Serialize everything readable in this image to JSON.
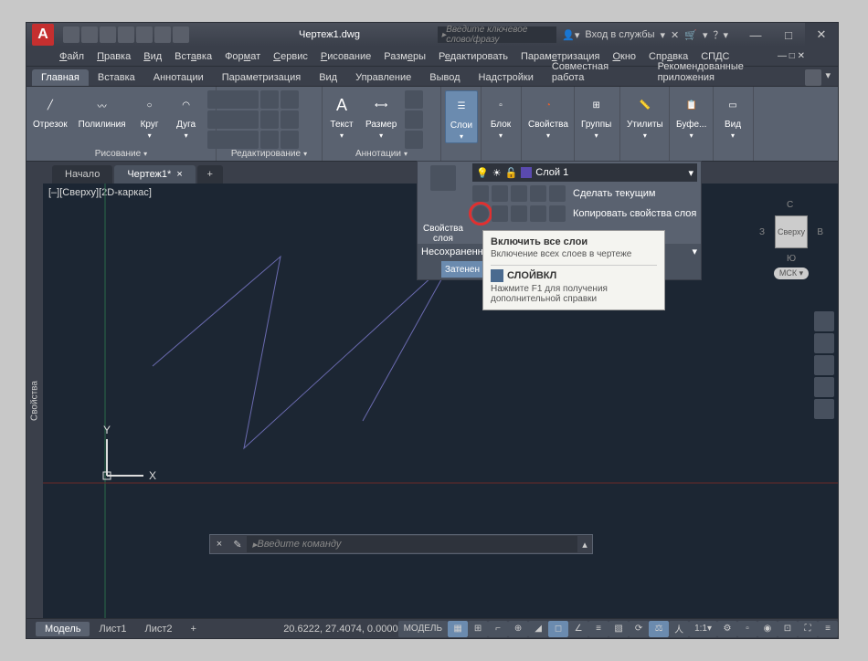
{
  "window": {
    "app_initial": "А",
    "title": "Чертеж1.dwg",
    "search_placeholder": "Введите ключевое слово/фразу",
    "login_label": "Вход в службы",
    "win_min": "—",
    "win_max": "□",
    "win_close": "✕"
  },
  "menubar": [
    "Файл",
    "Правка",
    "Вид",
    "Вставка",
    "Формат",
    "Сервис",
    "Рисование",
    "Размеры",
    "Редактировать",
    "Параметризация",
    "Окно",
    "Справка",
    "СПДС"
  ],
  "ribbon_tabs": [
    "Главная",
    "Вставка",
    "Аннотации",
    "Параметризация",
    "Вид",
    "Управление",
    "Вывод",
    "Надстройки",
    "Совместная работа",
    "Рекомендованные приложения"
  ],
  "ribbon_active": 0,
  "panels": {
    "draw": {
      "title": "Рисование",
      "items": [
        "Отрезок",
        "Полилиния",
        "Круг",
        "Дуга"
      ]
    },
    "modify": {
      "title": "Редактирование"
    },
    "annotation": {
      "title": "Аннотации",
      "items": [
        "Текст",
        "Размер"
      ]
    },
    "layers": {
      "title": "Слои"
    },
    "block": {
      "title": "Блок"
    },
    "properties": {
      "title": "Свойства"
    },
    "groups": {
      "title": "Группы"
    },
    "utilities": {
      "title": "Утилиты"
    },
    "clipboard": {
      "title": "Буфе..."
    },
    "view": {
      "title": "Вид"
    }
  },
  "filetabs": {
    "start": "Начало",
    "active": "Чертеж1*",
    "plus": "+"
  },
  "viewport": {
    "label": "[–][Сверху][2D-каркас]",
    "side_label": "Свойства",
    "axis_x": "X",
    "axis_y": "Y",
    "cube": "Сверху",
    "compass": {
      "n": "С",
      "s": "Ю",
      "e": "В",
      "w": "З"
    },
    "wcs": "МСК"
  },
  "layers_dropdown": {
    "props_label": "Свойства слоя",
    "current_layer": "Слой 1",
    "make_current": "Сделать текущим",
    "copy_props": "Копировать свойства слоя",
    "state_label": "Несохраненн",
    "state_value": "Затенен"
  },
  "tooltip": {
    "title": "Включить все слои",
    "desc": "Включение всех слоев в чертеже",
    "command": "СЛОЙВКЛ",
    "help": "Нажмите F1 для получения дополнительной справки"
  },
  "cmdline": {
    "close": "×",
    "placeholder": "Введите команду"
  },
  "bottom_tabs": [
    "Модель",
    "Лист1",
    "Лист2"
  ],
  "bottom_active": 0,
  "statusbar": {
    "coords": "20.6222, 27.4074, 0.0000",
    "space": "МОДЕЛЬ",
    "scale": "1:1"
  }
}
